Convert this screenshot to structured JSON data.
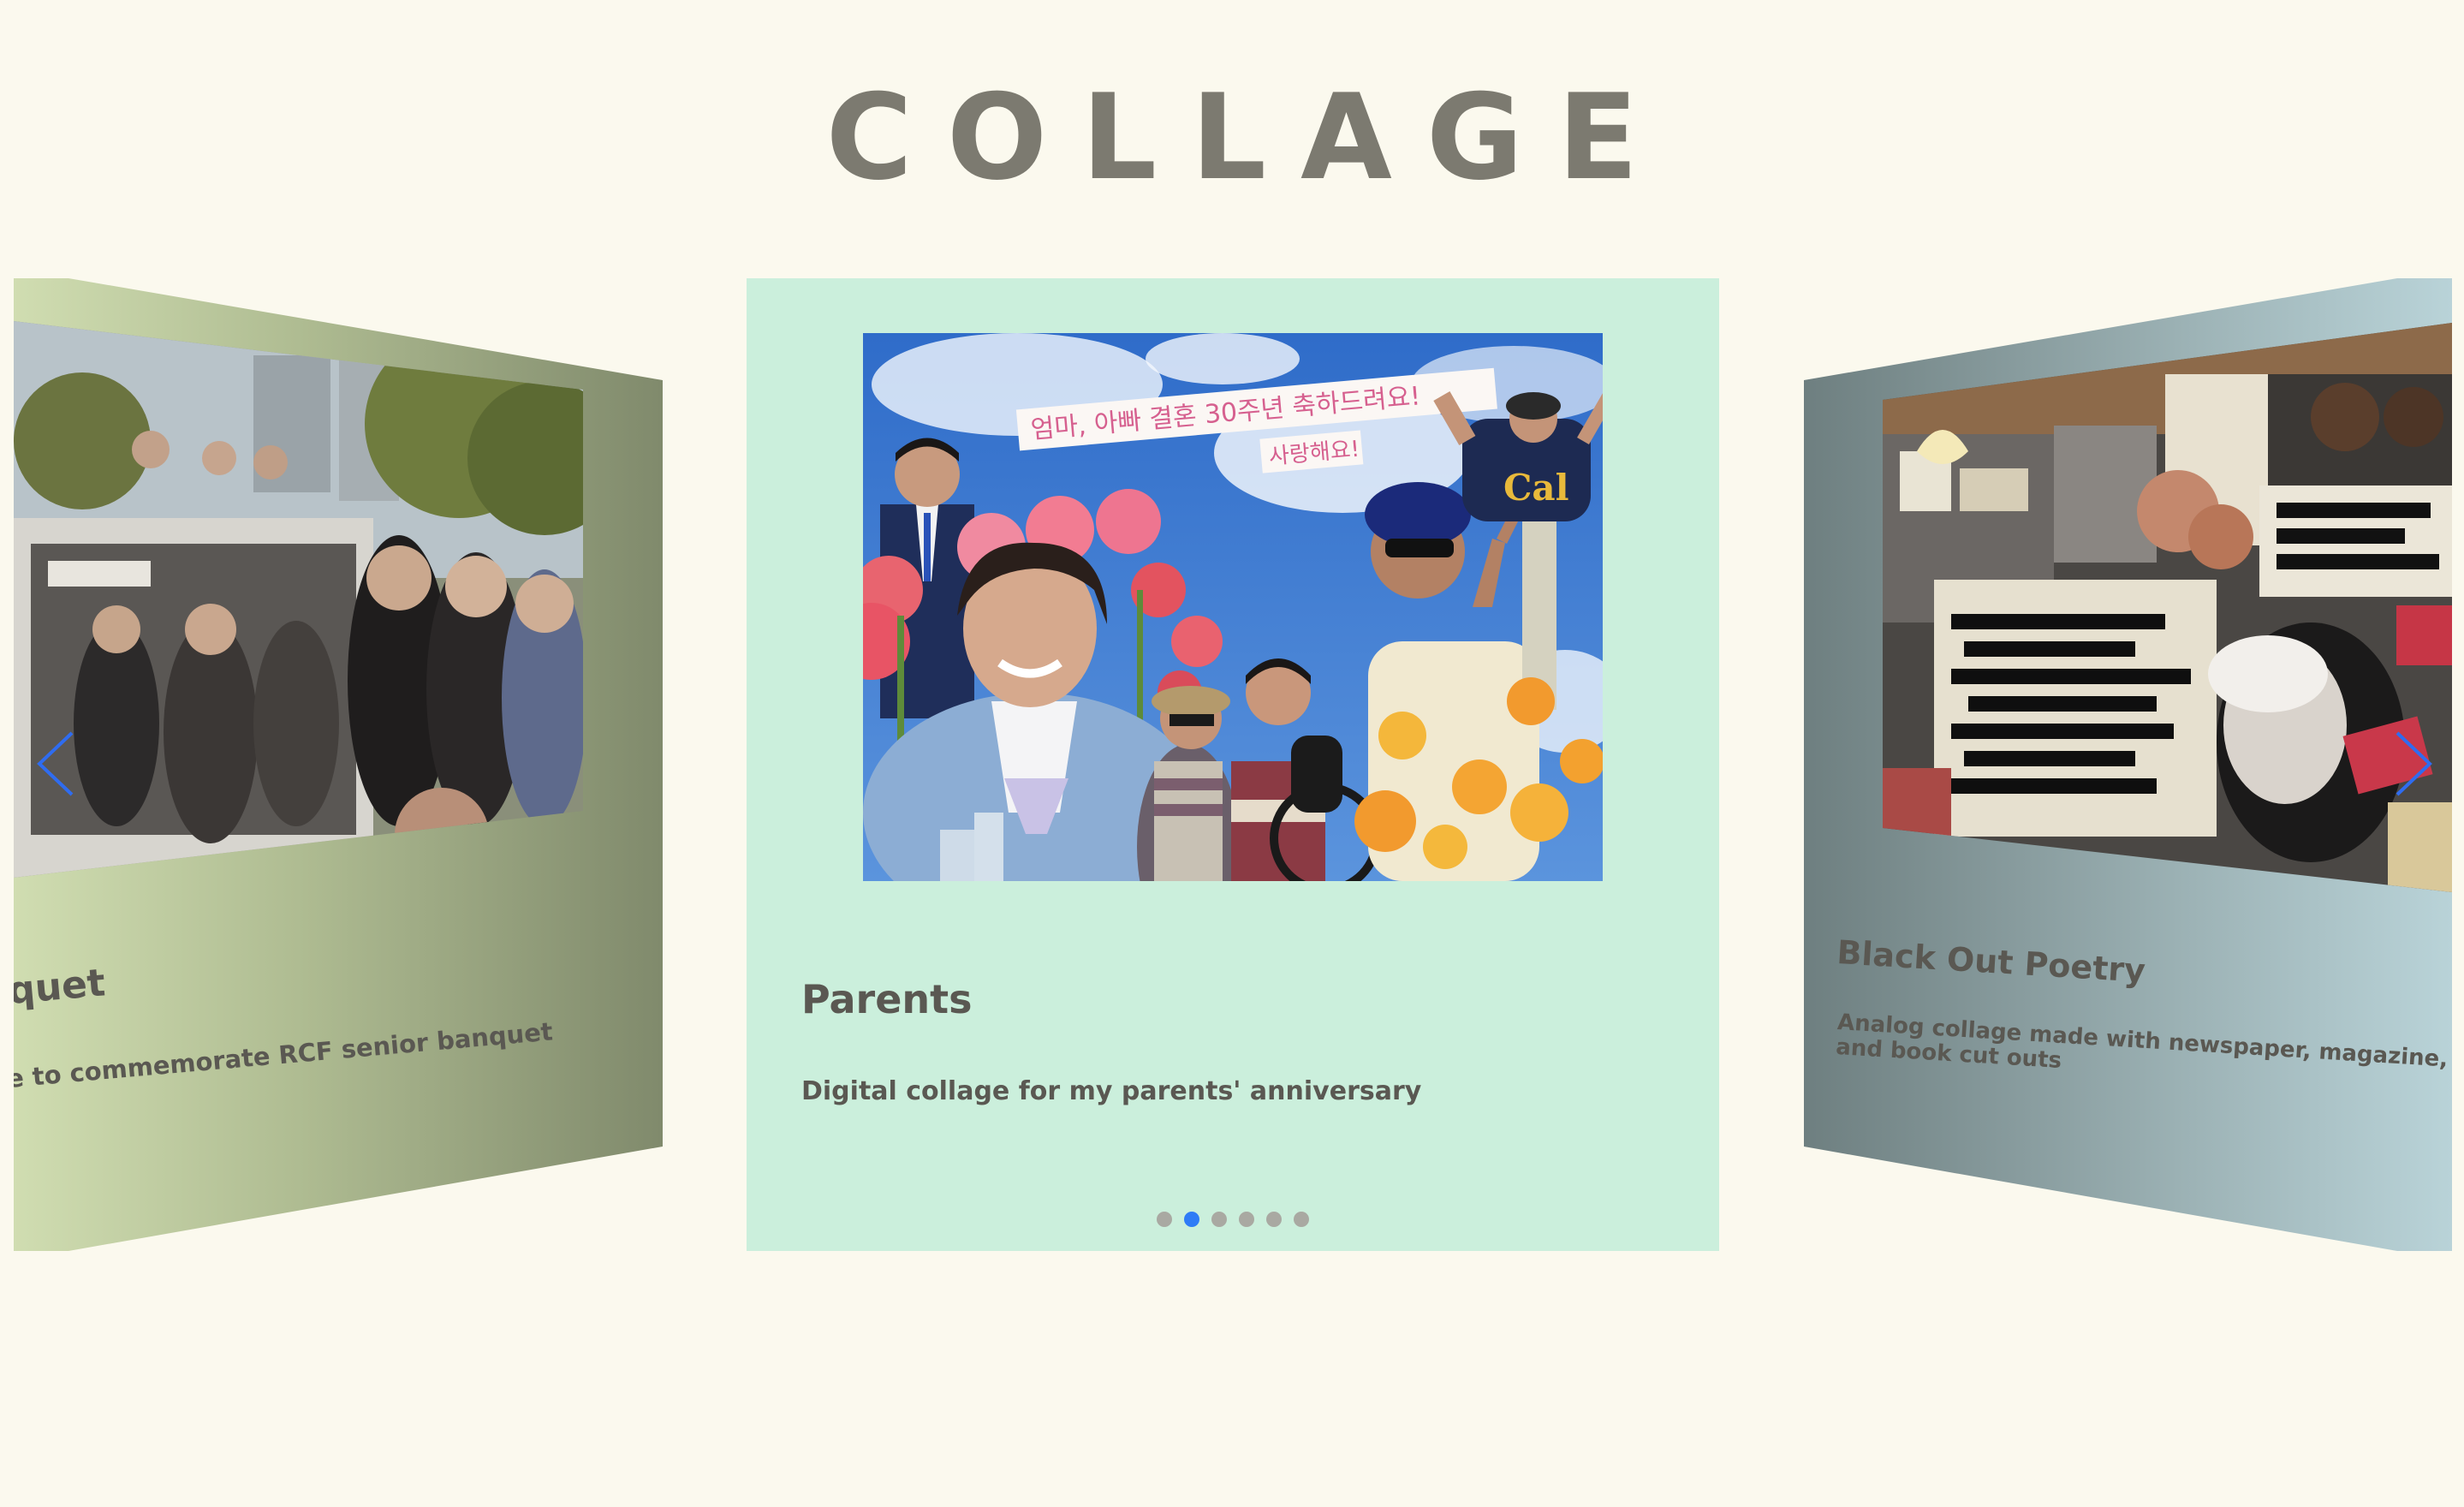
{
  "page": {
    "title": "COLLAGE"
  },
  "carousel": {
    "left_card": {
      "title": "nquet",
      "description": "ge to commemorate RCF senior banquet"
    },
    "center_card": {
      "title": "Parents",
      "description": "Digital collage for my parents' anniversary",
      "photo_text_line1": "엄마, 아빠 결혼 30주년 축하드려요!",
      "photo_text_line2": "사랑해요!",
      "cap_text": "Cal"
    },
    "right_card": {
      "title": "Black Out Poetry",
      "description": "Analog collage made with newspaper, magazine, and book cut outs"
    },
    "active_index": 1,
    "dot_count": 6,
    "prev_icon": "chevron-left-icon",
    "next_icon": "chevron-right-icon"
  },
  "colors": {
    "background": "#fbf9ee",
    "title": "#7c7a70",
    "center_card": "#cbefdc",
    "dot_active": "#2f7cf6",
    "dot_inactive": "#a9a9a2",
    "arrow": "#2f6cf0"
  }
}
